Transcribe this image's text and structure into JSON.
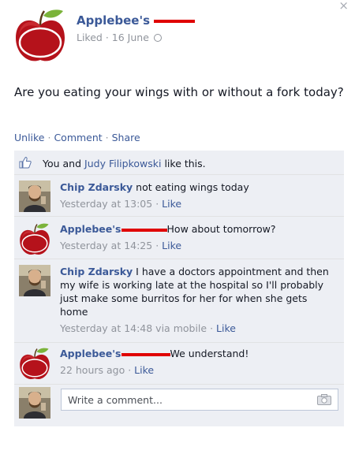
{
  "post": {
    "page_name": "Applebee's",
    "liked": "Liked",
    "date": "16 June",
    "status_text": "Are you eating your wings with or without a fork today?"
  },
  "actions": {
    "unlike": "Unlike",
    "comment": "Comment",
    "share": "Share"
  },
  "likes": {
    "you_and": "You and",
    "friend": "Judy Filipkowski",
    "suffix": "like this."
  },
  "comments": [
    {
      "author": "Chip Zdarsky",
      "text": "not eating wings today",
      "time": "Yesterday at 13:05",
      "like": "Like"
    },
    {
      "author": "Applebee's",
      "text": "How about tomorrow?",
      "time": "Yesterday at 14:25",
      "like": "Like"
    },
    {
      "author": "Chip Zdarsky",
      "text": "I have a doctors appointment and then my wife is working late at the hospital so I'll probably just make some burritos for her for when she gets home",
      "time": "Yesterday at 14:48 via mobile",
      "like": "Like"
    },
    {
      "author": "Applebee's",
      "text": "We understand!",
      "time": "22 hours ago",
      "like": "Like"
    }
  ],
  "write_comment": {
    "placeholder": "Write a comment..."
  },
  "colors": {
    "link": "#3b5998",
    "redaction": "#e00000",
    "panel": "#edeff4"
  },
  "icons": [
    "close-icon",
    "apple-logo-icon",
    "globe-icon",
    "thumbs-up-icon",
    "camera-icon"
  ]
}
